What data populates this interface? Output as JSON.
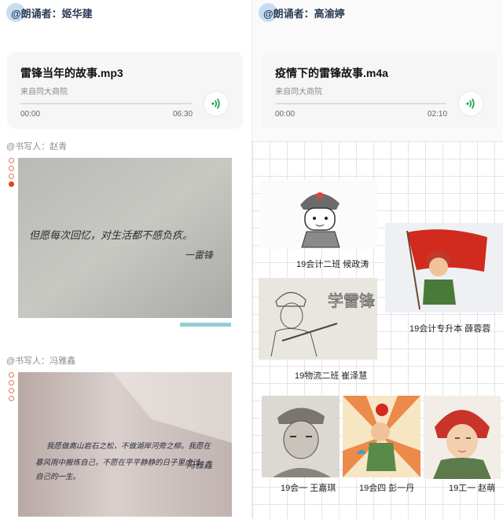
{
  "left": {
    "narrator": "@朗诵者：姬华建",
    "audio": {
      "title": "雷锋当年的故事.mp3",
      "source": "来自同大商院",
      "time_start": "00:00",
      "time_end": "06:30"
    },
    "writer1": "@书写人：赵青",
    "calligraphy1": {
      "line1": "但愿每次回忆，对生活都不感负疚。",
      "signature": "一雷锋"
    },
    "writer2": "@书写人：冯雅鑫",
    "calligraphy2": {
      "line1": "我愿做高山岩石之松，不做湖岸河旁之柳。我愿在",
      "line2": "暴风雨中搬炼自己，不愿在平平静静的日子里虚过",
      "line3": "自己的一生。",
      "signature": "冯雅鑫"
    }
  },
  "right": {
    "narrator": "@朗诵者：高渝婷",
    "audio": {
      "title": "疫情下的雷锋故事.m4a",
      "source": "来自同大商院",
      "time_start": "00:00",
      "time_end": "02:10"
    },
    "artworks": [
      {
        "caption": "19会计二班   候政涛"
      },
      {
        "caption": "19会计专升本   薛蓉蓉"
      },
      {
        "caption": "19物流二班   崔泽慧",
        "drawing_text": "学雷锋"
      },
      {
        "caption": "19会一 王嘉琪"
      },
      {
        "caption": "19会四   彭一丹"
      },
      {
        "caption": "19工一   赵萌"
      }
    ]
  },
  "colors": {
    "accent_green": "#23a455",
    "bullet_red": "#e0451d",
    "narrator_dot": "#bcd6ef"
  },
  "icons": {
    "play": "audio-wave-icon"
  }
}
